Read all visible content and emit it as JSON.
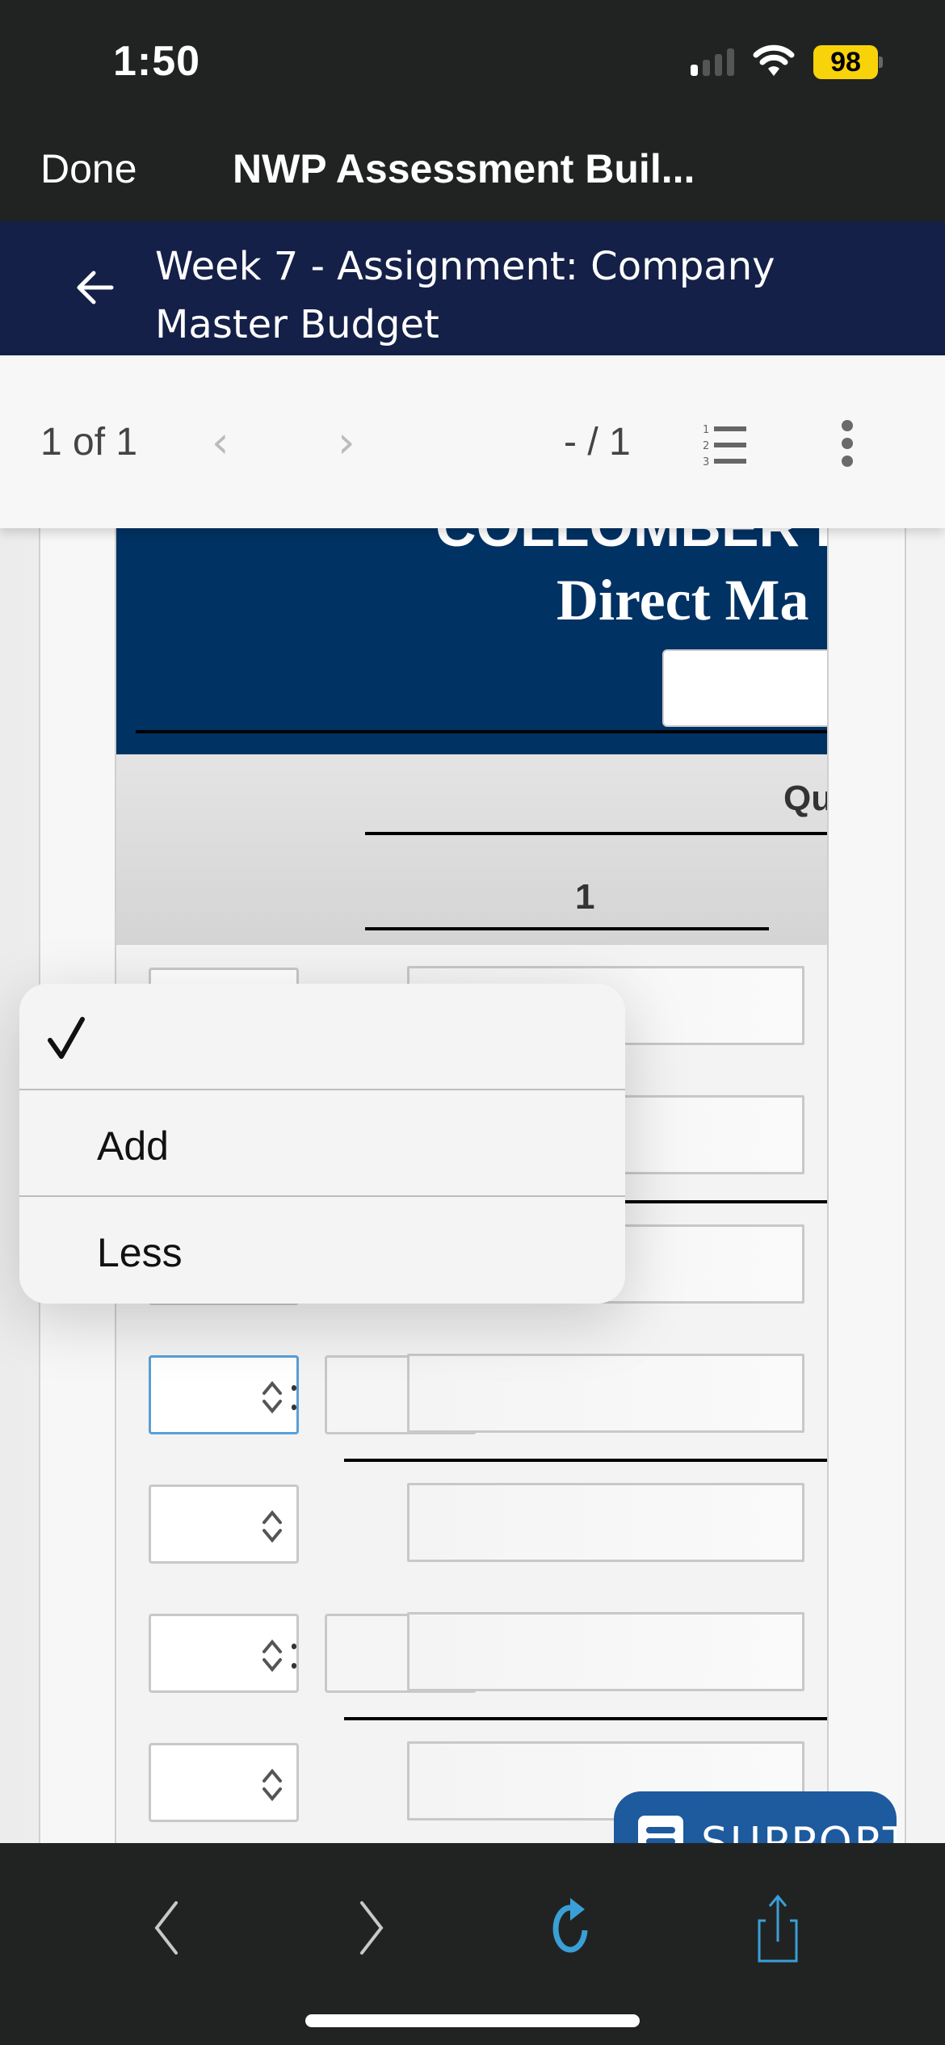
{
  "status_bar": {
    "time": "1:50",
    "battery": "98",
    "icons": [
      "signal-icon",
      "wifi-icon",
      "battery-icon"
    ]
  },
  "browser": {
    "done_label": "Done",
    "title": "NWP Assessment Buil..."
  },
  "app_header": {
    "back_icon": "arrow-left-icon",
    "title": "Week 7 - Assignment: Company Master Budget"
  },
  "pager": {
    "count": "1 of 1",
    "prev_icon": "chevron-left-icon",
    "next_icon": "chevron-right-icon",
    "page_indicator": "- / 1",
    "list_icon": "numbered-list-icon",
    "more_icon": "more-vertical-icon"
  },
  "document": {
    "company_name": "COLLOMBER I",
    "schedule_title": "Direct Ma",
    "quarter_label": "Qu",
    "quarter_number": "1",
    "rows": [
      {
        "type": "select",
        "value": "",
        "has_small_box": false
      },
      {
        "type": "select",
        "value": "",
        "has_small_box": false
      },
      {
        "type": "select",
        "value": "",
        "has_small_box": false
      },
      {
        "type": "select",
        "value": "",
        "has_small_box": true,
        "focused": true
      },
      {
        "type": "select",
        "value": "",
        "has_small_box": false
      },
      {
        "type": "select",
        "value": "",
        "has_small_box": true
      },
      {
        "type": "select",
        "value": "",
        "has_small_box": false
      }
    ]
  },
  "dropdown": {
    "selected_index": 0,
    "options": [
      {
        "label": "",
        "checked": true
      },
      {
        "label": "Add",
        "checked": false
      },
      {
        "label": "Less",
        "checked": false
      }
    ]
  },
  "support": {
    "label": "SUPPORT"
  },
  "bottom_toolbar": {
    "icons": [
      "back-icon",
      "forward-icon",
      "reload-icon",
      "share-icon"
    ]
  },
  "colors": {
    "dark_bg": "#212323",
    "app_header": "#142048",
    "doc_header": "#003263",
    "focus_blue": "#5a9fd6",
    "support_blue": "#1d5a9e",
    "toolbar_accent": "#3a9fd6",
    "battery_yellow": "#f9d30a"
  }
}
